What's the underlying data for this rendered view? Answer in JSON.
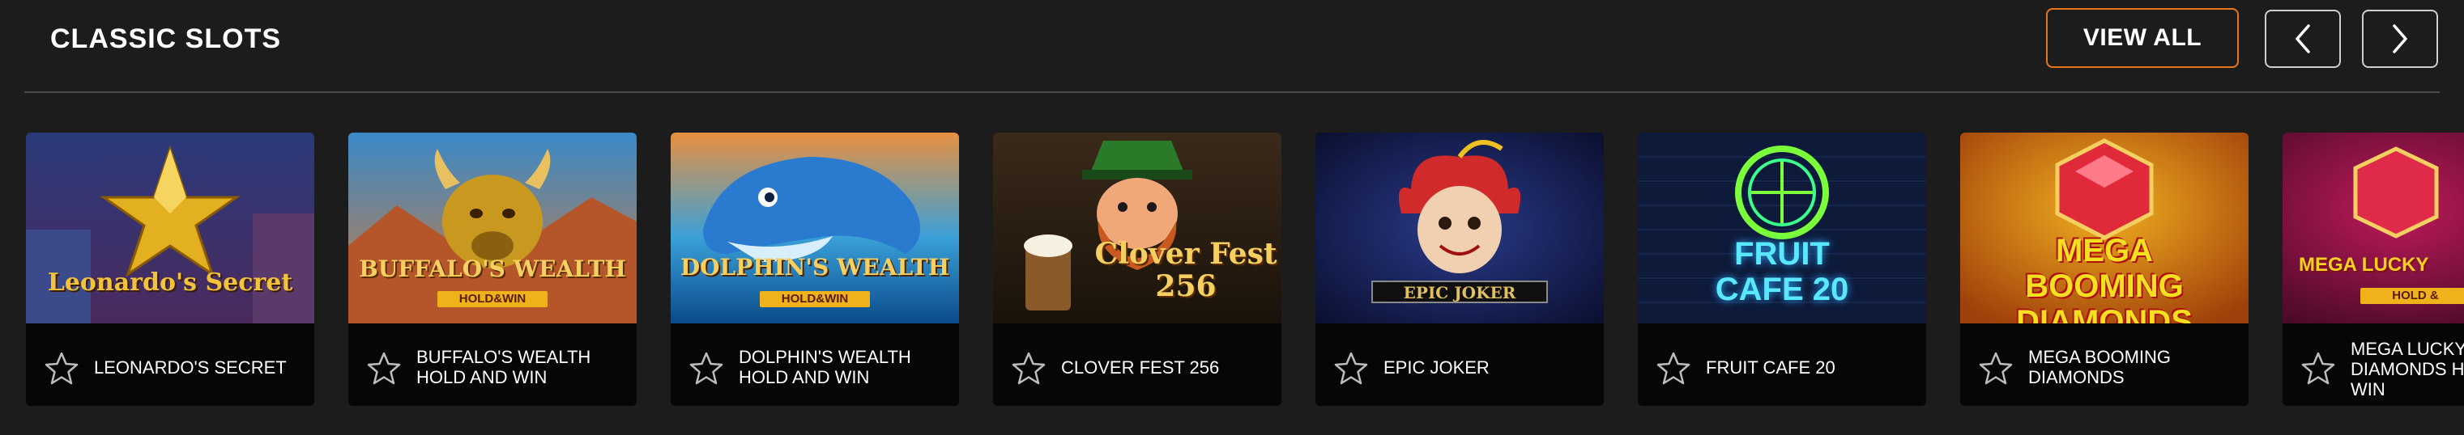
{
  "section": {
    "title": "CLASSIC SLOTS",
    "view_all_label": "VIEW ALL",
    "prev_icon": "chevron-left-icon",
    "next_icon": "chevron-right-icon"
  },
  "colors": {
    "background": "#1c1c1c",
    "accent": "#e8751a",
    "card_footer": "#060606"
  },
  "games": [
    {
      "name": "LEONARDO'S SECRET",
      "art_title": "Leonardo's Secret",
      "art_sub": ""
    },
    {
      "name": "BUFFALO'S WEALTH HOLD AND WIN",
      "art_title": "BUFFALO'S WEALTH",
      "art_sub": "HOLD&WIN"
    },
    {
      "name": "DOLPHIN'S WEALTH HOLD AND WIN",
      "art_title": "DOLPHIN'S WEALTH",
      "art_sub": "HOLD&WIN"
    },
    {
      "name": "CLOVER FEST 256",
      "art_title": "Clover Fest 256",
      "art_sub": ""
    },
    {
      "name": "EPIC JOKER",
      "art_title": "EPIC JOKER",
      "art_sub": ""
    },
    {
      "name": "FRUIT CAFE 20",
      "art_title": "FRUIT CAFE 20",
      "art_sub": ""
    },
    {
      "name": "MEGA BOOMING DIAMONDS",
      "art_title": "MEGA BOOMING DIAMONDS",
      "art_sub": ""
    },
    {
      "name": "MEGA LUCKY DIAMONDS HOLD AND WIN",
      "art_title": "MEGA LUCKY",
      "art_sub": "HOLD &"
    }
  ]
}
